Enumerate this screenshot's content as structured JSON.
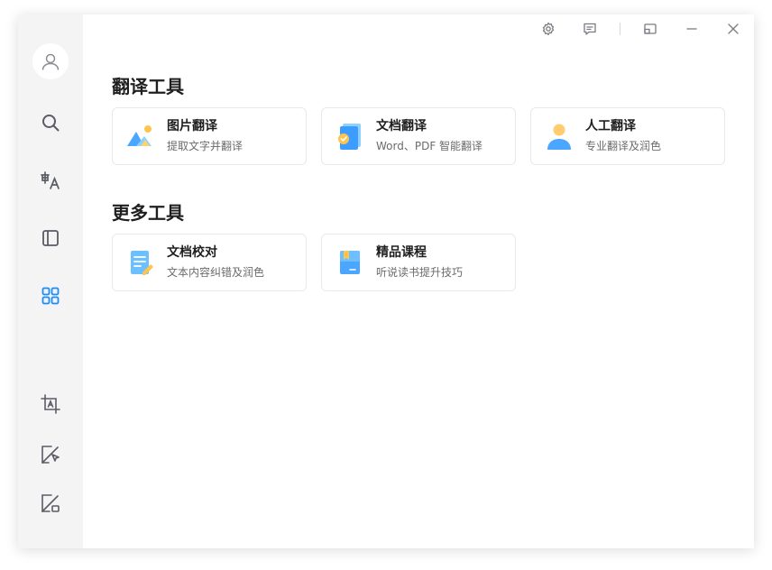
{
  "sections": [
    {
      "title": "翻译工具",
      "cards": [
        {
          "title": "图片翻译",
          "subtitle": "提取文字并翻译",
          "icon": "image-mountain-icon"
        },
        {
          "title": "文档翻译",
          "subtitle": "Word、PDF 智能翻译",
          "icon": "document-translate-icon"
        },
        {
          "title": "人工翻译",
          "subtitle": "专业翻译及润色",
          "icon": "person-icon"
        }
      ]
    },
    {
      "title": "更多工具",
      "cards": [
        {
          "title": "文档校对",
          "subtitle": "文本内容纠错及润色",
          "icon": "document-edit-icon"
        },
        {
          "title": "精品课程",
          "subtitle": "听说读书提升技巧",
          "icon": "bookmark-book-icon"
        }
      ]
    }
  ],
  "colors": {
    "accent": "#1a8cff",
    "sidebar_bg": "#f4f4f5",
    "icon_gray": "#5b5b66"
  }
}
